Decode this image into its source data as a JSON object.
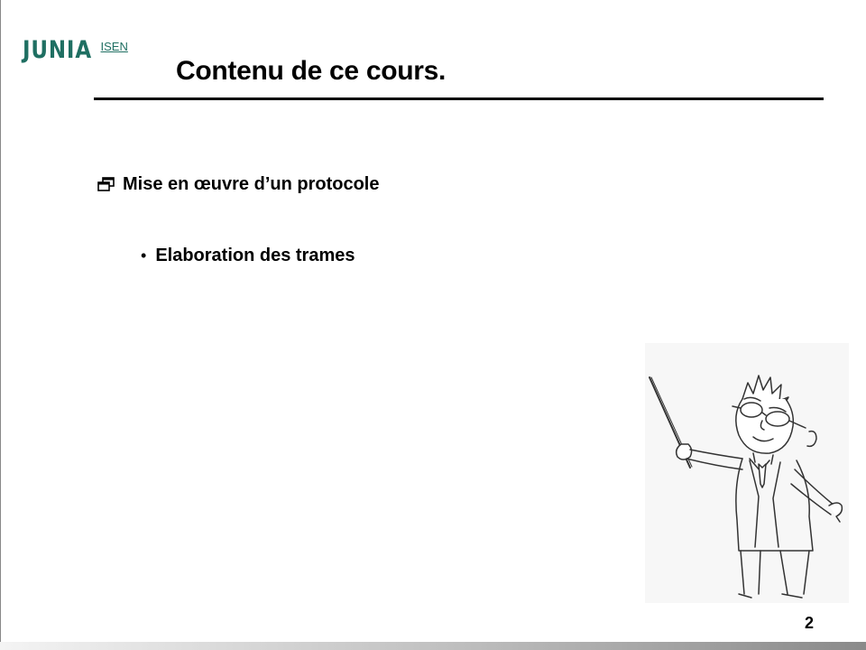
{
  "logo": {
    "brand": "JUNIA",
    "sub": "ISEN"
  },
  "slide": {
    "title": "Contenu de ce cours.",
    "items": [
      {
        "icon": "window-restore-icon",
        "text": "Mise en œuvre d’un protocole",
        "subitems": [
          {
            "bullet": "•",
            "text": "Elaboration des trames"
          }
        ]
      }
    ],
    "illustration": "teacher-with-pointer-cartoon",
    "page_number": "2"
  },
  "colors": {
    "brand": "#1f6f62",
    "text": "#000000",
    "rule": "#000000"
  }
}
